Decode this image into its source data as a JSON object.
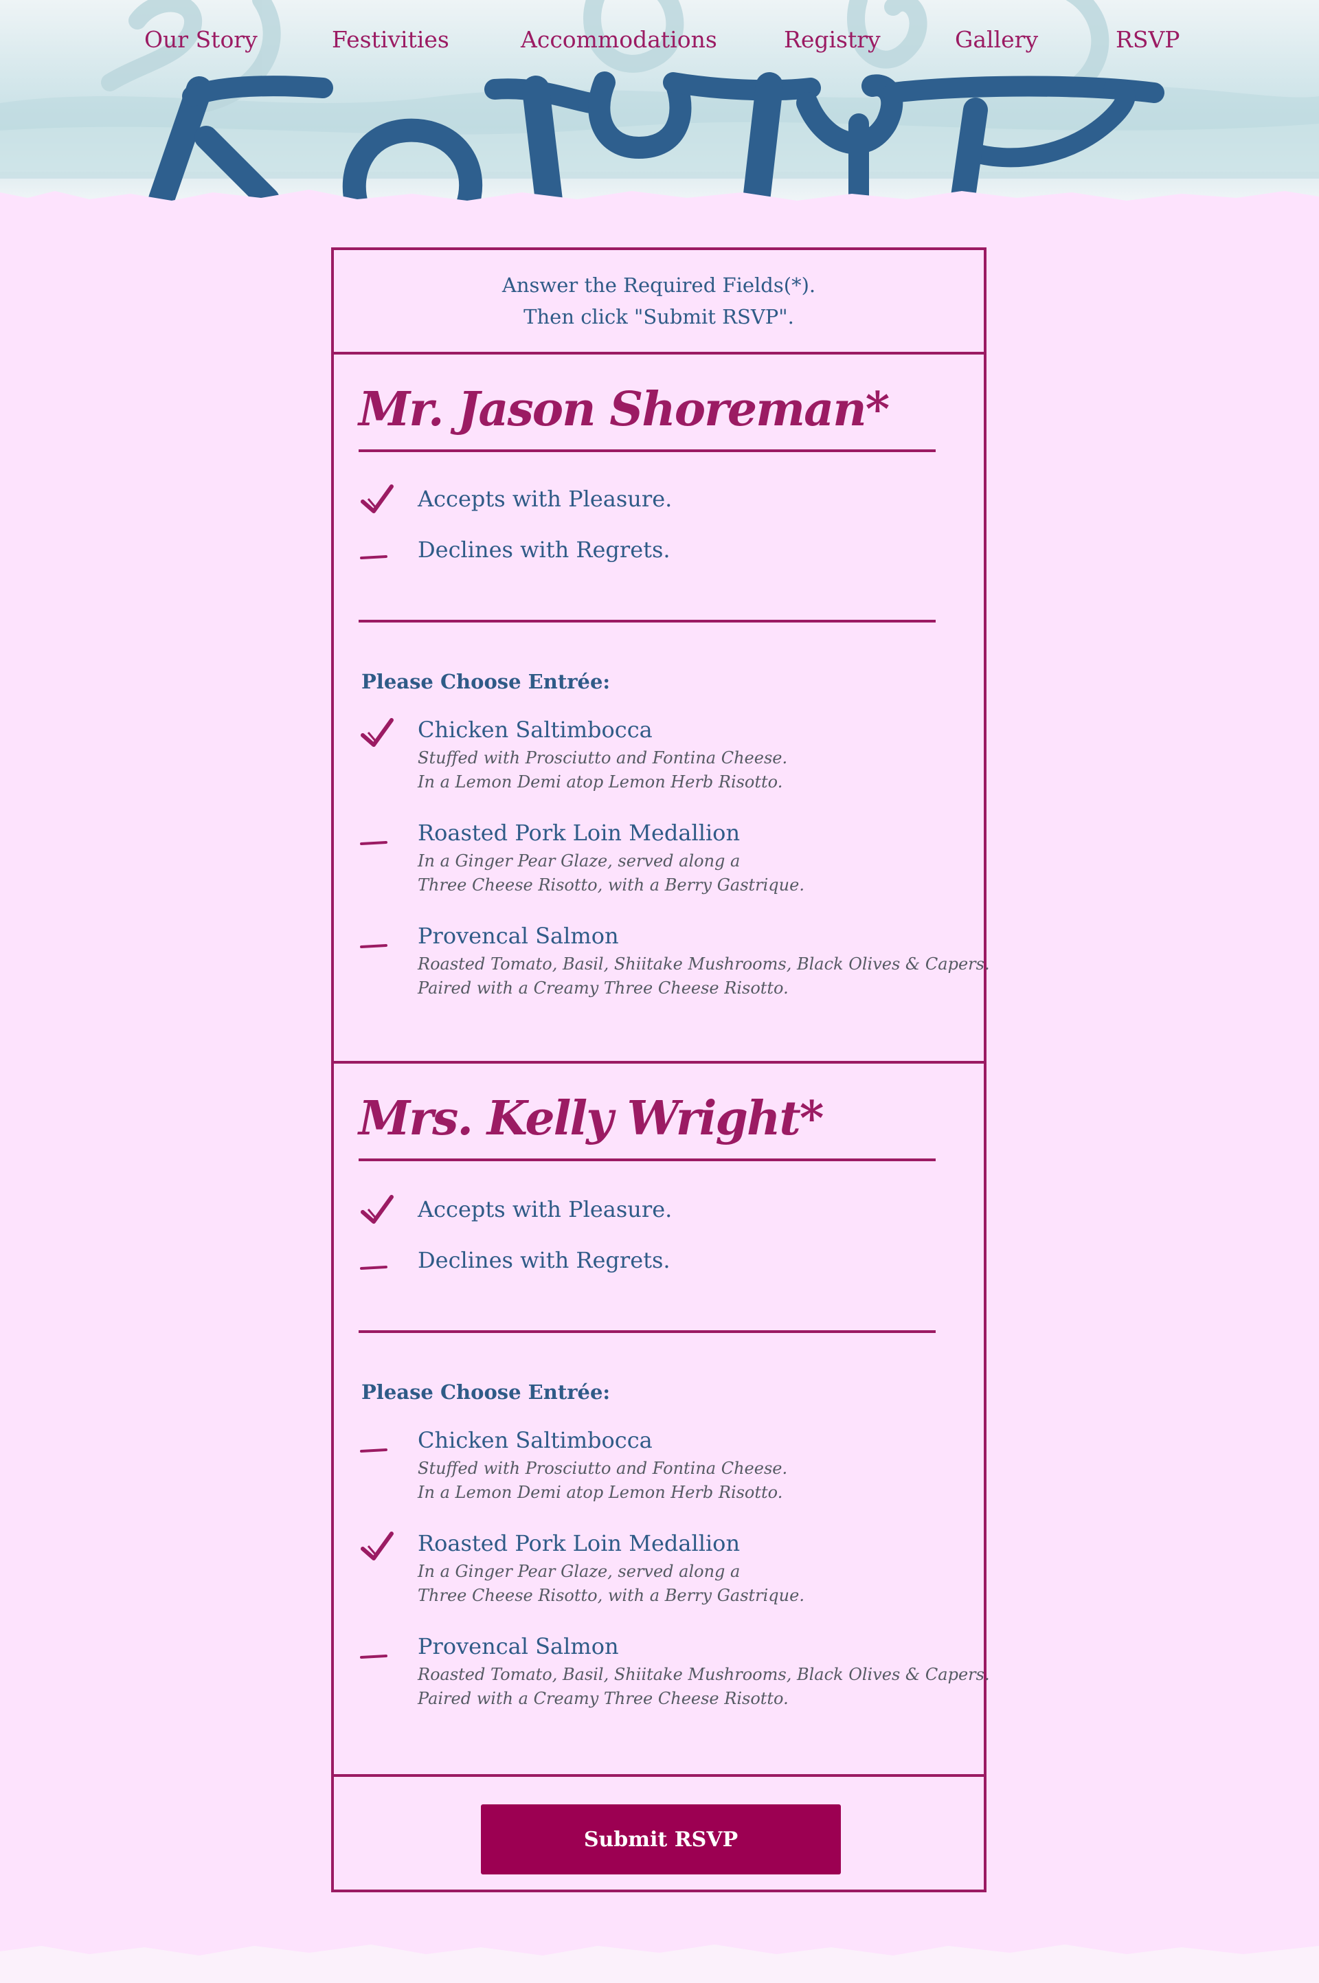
{
  "nav": {
    "items": [
      {
        "label": "Our Story"
      },
      {
        "label": "Festivities"
      },
      {
        "label": "Accommodations"
      },
      {
        "label": "Registry"
      },
      {
        "label": "Gallery"
      },
      {
        "label": "RSVP"
      }
    ]
  },
  "intro": {
    "line1": "Answer the Required Fields(*).",
    "line2": "Then click \"Submit RSVP\"."
  },
  "guests": [
    {
      "name": "Mr. Jason Shoreman*",
      "attendance": [
        {
          "label": "Accepts with Pleasure.",
          "selected": true
        },
        {
          "label": "Declines with Regrets.",
          "selected": false
        }
      ],
      "entree_title": "Please Choose Entrée:",
      "entrees": [
        {
          "label": "Chicken Saltimbocca",
          "desc1": "Stuffed with Prosciutto and Fontina Cheese.",
          "desc2": "In a Lemon Demi atop Lemon Herb Risotto.",
          "selected": true
        },
        {
          "label": "Roasted Pork Loin Medallion",
          "desc1": "In a Ginger Pear Glaze, served along a",
          "desc2": "Three Cheese Risotto, with a Berry Gastrique.",
          "selected": false
        },
        {
          "label": "Provencal Salmon",
          "desc1": "Roasted Tomato, Basil, Shiitake Mushrooms, Black Olives & Capers.",
          "desc2": "Paired with a Creamy Three Cheese Risotto.",
          "selected": false
        }
      ]
    },
    {
      "name": "Mrs. Kelly Wright*",
      "attendance": [
        {
          "label": "Accepts with Pleasure.",
          "selected": true
        },
        {
          "label": "Declines with Regrets.",
          "selected": false
        }
      ],
      "entree_title": "Please Choose Entrée:",
      "entrees": [
        {
          "label": "Chicken Saltimbocca",
          "desc1": "Stuffed with Prosciutto and Fontina Cheese.",
          "desc2": "In a Lemon Demi atop Lemon Herb Risotto.",
          "selected": false
        },
        {
          "label": "Roasted Pork Loin Medallion",
          "desc1": "In a Ginger Pear Glaze, served along a",
          "desc2": "Three Cheese Risotto, with a Berry Gastrique.",
          "selected": true
        },
        {
          "label": "Provencal Salmon",
          "desc1": "Roasted Tomato, Basil, Shiitake Mushrooms, Black Olives & Capers.",
          "desc2": "Paired with a Creamy Three Cheese Risotto.",
          "selected": false
        }
      ]
    }
  ],
  "submit": {
    "label": "Submit RSVP"
  },
  "colors": {
    "accent": "#9b1b63",
    "text": "#2f5b87",
    "background": "#fde3fd",
    "button": "#9c0052",
    "banner_lettering": "#2e5f8e"
  },
  "icons": {
    "selected": "check-icon",
    "unselected": "dash-icon"
  }
}
